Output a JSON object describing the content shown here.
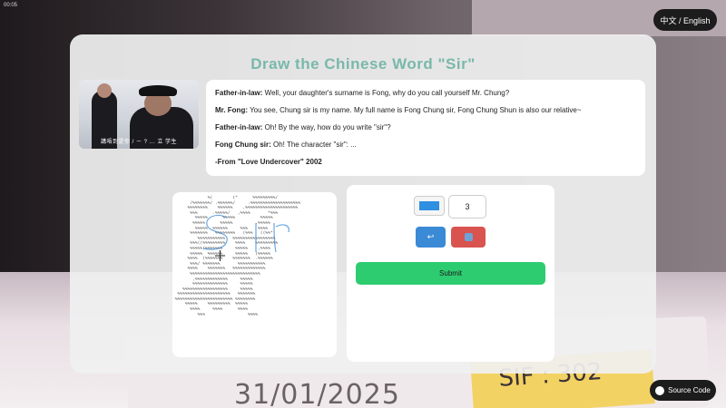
{
  "status": {
    "time": "00:05"
  },
  "lang_toggle": "中文 / English",
  "title": "Draw the Chinese Word \"Sir\"",
  "thumbnail": {
    "subtitle": "講唔到是你 / ㄧ ? ... 立 学生"
  },
  "dialogue": [
    {
      "speaker": "Father-in-law:",
      "text": " Well, your daughter's surname is Fong, why do you call yourself Mr. Chung?"
    },
    {
      "speaker": "Mr. Fong:",
      "text": " You see, Chung sir is my name. My full name is Fong Chung sir, Fong Chung Shun is also our relative~"
    },
    {
      "speaker": "Father-in-law:",
      "text": " Oh! By the way, how do you write \"sir\"?"
    },
    {
      "speaker": "Fong Chung sir:",
      "text": " Oh! The character \"sir\": ..."
    },
    {
      "speaker": "-From \"Love Undercover\" 2002",
      "text": ""
    }
  ],
  "canvas": {
    "ascii_lines": [
      "              %(        (*      %%%%%%%%%/",
      "       /%%%%%%%/ .%%%%%%/     .%%%%%%%%%%%%%%%%%%%%",
      "      %%%%%%%%    %%%%%%    ,%%%%%%%%%%%%%%%%%%%%%",
      "       %%%      .%%%%%/   ,%%%%       *%%%",
      "         %%%%%      %%%%%          %%%%%",
      "        %%%%%      %%%%%         .%%%%%",
      "         %%%%%  %%%%%%     %%%    %%%%",
      "       %%%%%%%   %%%%%%%%   (%%%   ((%%*",
      "          %%%%%%%%%%%   %%%%%%%%%%%%%%%%%",
      "       %%%((%%%%%%%%%    %%%%    %%%%%%%%%",
      "       %%%%%(%%%%%%%     %%%%%    ,%%%%",
      "       %%%%%  %%%%%%     %%%%%   (%%%%%",
      "      %%%%  (%%%%%%%    %%%%%%%  .%%%%%%",
      "       %%%/ %%%%%%%       %%%%%%%%%%%",
      "      %%%%    %%%%%%%   %%%%%%%%%%%%%",
      "       %%%%%%%%%%%%%%%%%%%%%%%%%%%%",
      "        ,%%%%%%%%%%%%%     %%%%%",
      "        %%%%%%%%%%%%%%     %%%%%",
      "    %%%%%%%%%%%%%%%%%%     %%%%%",
      "  %%%%%%%%%%%%%%%%%%%%%   %%%%%%%",
      " %%%%%%%%%%%%%%%%%%%%%%% %%%%%%%%",
      "     %%%%%    %%%%%%%%%  %%%%%",
      "       %%%%     %%%%      %%%%",
      "          %%%                 %%%%"
    ]
  },
  "controls": {
    "color": "#2f8fe0",
    "size_value": "3",
    "undo_icon": "↩",
    "clear_icon": "trash-icon",
    "submit_label": "Submit"
  },
  "source_button": "Source Code",
  "background": {
    "date_text": "31/01/2025",
    "tag_text": "SIF : 302"
  }
}
